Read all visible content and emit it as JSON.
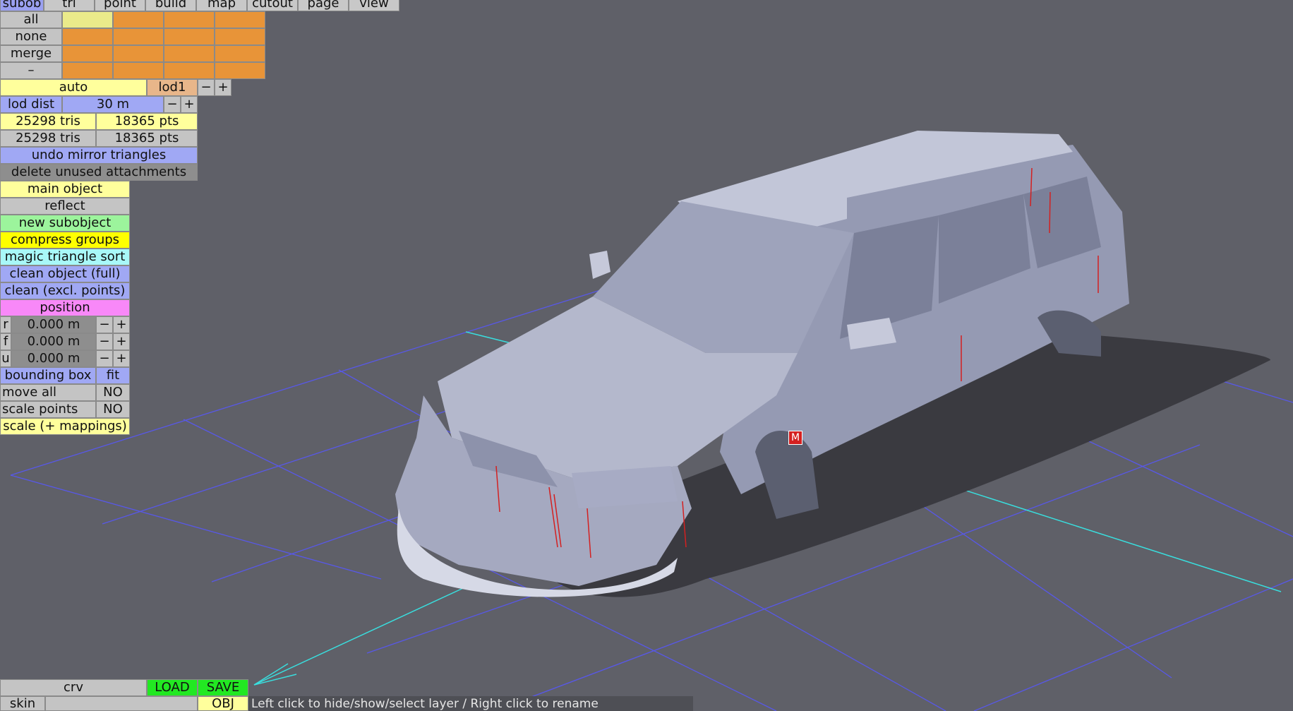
{
  "tabs": [
    "subob",
    "tri",
    "point",
    "build",
    "map",
    "cutout",
    "page",
    "view"
  ],
  "layer_rows": [
    "all",
    "none",
    "merge",
    "–"
  ],
  "lod": {
    "mode": "auto",
    "name": "lod1",
    "minus": "−",
    "plus": "+"
  },
  "lod_dist": {
    "label": "lod dist",
    "value": "30 m",
    "minus": "−",
    "plus": "+"
  },
  "counts": [
    {
      "tris": "25298 tris",
      "pts": "18365 pts"
    },
    {
      "tris": "25298 tris",
      "pts": "18365 pts"
    }
  ],
  "actions": {
    "undo_mirror": "undo mirror triangles",
    "delete_unused": "delete unused attachments",
    "main_object": "main object",
    "reflect": "reflect",
    "new_subobject": "new subobject",
    "compress_groups": "compress groups",
    "magic_sort": "magic triangle sort",
    "clean_full": "clean object (full)",
    "clean_excl": "clean (excl. points)",
    "position": "position"
  },
  "position": [
    {
      "axis": "r",
      "value": "0.000 m"
    },
    {
      "axis": "f",
      "value": "0.000 m"
    },
    {
      "axis": "u",
      "value": "0.000 m"
    }
  ],
  "bbox": {
    "label": "bounding box",
    "fit": "fit"
  },
  "move_all": {
    "label": "move all",
    "value": "NO"
  },
  "scale_points": {
    "label": "scale points",
    "value": "NO"
  },
  "scale_mappings": "scale (+ mappings)",
  "bottom": {
    "file_name": "crv",
    "load": "LOAD",
    "save": "SAVE",
    "skin_label": "skin",
    "skin_value": "",
    "obj": "OBJ",
    "status": "Left click to hide/show/select layer / Right click to rename"
  },
  "viewport": {
    "marker": "M"
  }
}
